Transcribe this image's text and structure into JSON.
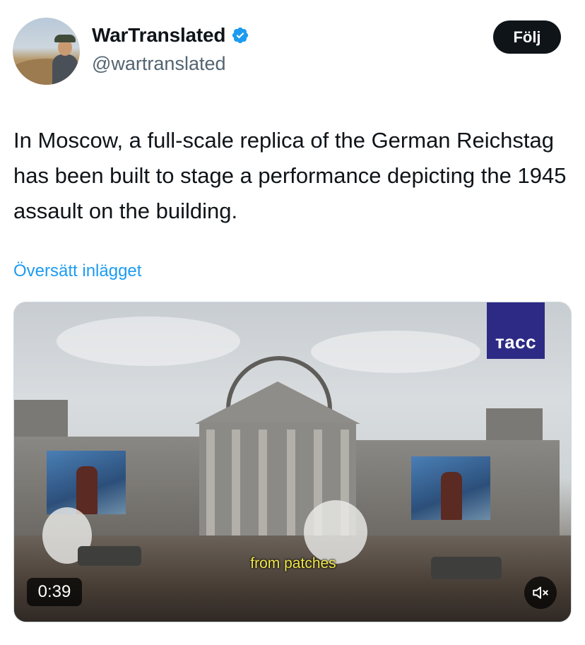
{
  "author": {
    "display_name": "WarTranslated",
    "handle": "@wartranslated",
    "verified_icon": "verified-badge-icon"
  },
  "follow_button": {
    "label": "Följ"
  },
  "tweet": {
    "text": "In Moscow, a full-scale replica of the German Reichstag has been built to stage a performance depicting the 1945 assault on the building.",
    "translate_label": "Översätt inlägget"
  },
  "media": {
    "logo_text": "тасс",
    "subtitle": "from patches",
    "duration": "0:39",
    "mute_icon": "volume-muted-icon"
  },
  "colors": {
    "link": "#1d9bf0",
    "verified": "#1d9bf0",
    "follow_bg": "#0f1419",
    "logo_bg": "#2d2a86",
    "subtitle": "#f2e84a"
  }
}
